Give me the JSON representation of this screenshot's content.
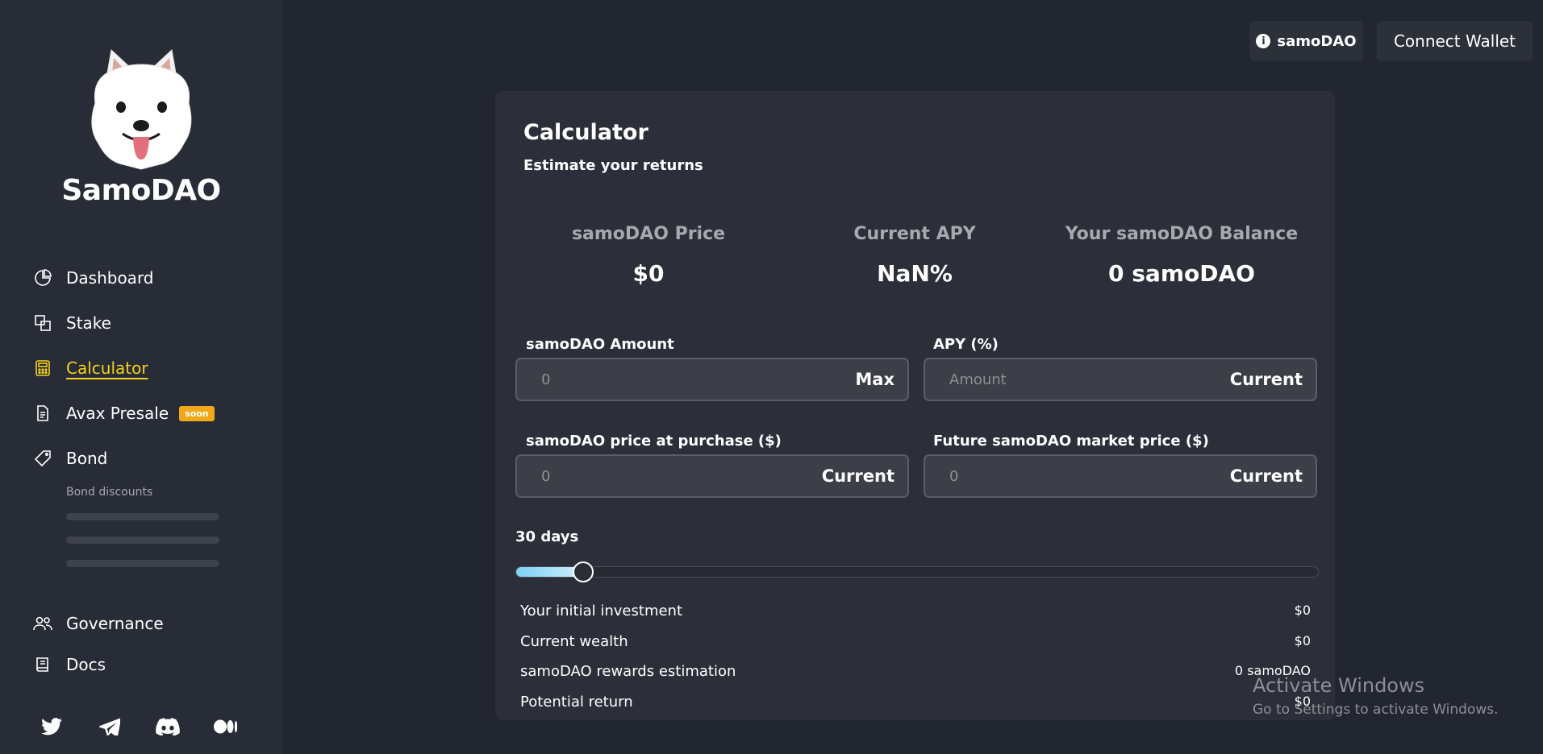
{
  "brand": {
    "name": "SamoDAO"
  },
  "nav": [
    {
      "label": "Dashboard",
      "icon": "pie-chart-icon"
    },
    {
      "label": "Stake",
      "icon": "stake-icon"
    },
    {
      "label": "Calculator",
      "icon": "calculator-icon",
      "active": true
    },
    {
      "label": "Avax Presale",
      "icon": "document-icon",
      "badge": "soon"
    },
    {
      "label": "Bond",
      "icon": "tag-icon"
    },
    {
      "label": "Governance",
      "icon": "people-icon"
    },
    {
      "label": "Docs",
      "icon": "book-icon"
    }
  ],
  "bond": {
    "subtitle": "Bond discounts"
  },
  "socials": [
    "twitter-icon",
    "telegram-icon",
    "discord-icon",
    "medium-icon"
  ],
  "header": {
    "token_label": "samoDAO",
    "wallet_label": "Connect Wallet"
  },
  "card": {
    "title": "Calculator",
    "subtitle": "Estimate your returns",
    "stats": [
      {
        "title": "samoDAO Price",
        "value": "$0"
      },
      {
        "title": "Current APY",
        "value": "NaN%"
      },
      {
        "title": "Your samoDAO Balance",
        "value": "0 samoDAO"
      }
    ],
    "fields": {
      "amount": {
        "label": "samoDAO Amount",
        "placeholder": "0",
        "action": "Max"
      },
      "apy": {
        "label": "APY (%)",
        "placeholder": "Amount",
        "action": "Current"
      },
      "purchase_price": {
        "label": "samoDAO price at purchase ($)",
        "placeholder": "0",
        "action": "Current"
      },
      "future_price": {
        "label": "Future samoDAO market price ($)",
        "placeholder": "0",
        "action": "Current"
      }
    },
    "days_label": "30 days",
    "slider": {
      "value": 30,
      "max": 365
    },
    "results": [
      {
        "label": "Your initial investment",
        "value": "$0"
      },
      {
        "label": "Current wealth",
        "value": "$0"
      },
      {
        "label": "samoDAO rewards estimation",
        "value": "0 samoDAO"
      },
      {
        "label": "Potential return",
        "value": "$0"
      }
    ]
  },
  "watermark": {
    "title": "Activate Windows",
    "subtitle": "Go to Settings to activate Windows."
  },
  "colors": {
    "accent": "#f6d21a",
    "badge": "#f1a91b",
    "slider": "#7fd0f5"
  }
}
